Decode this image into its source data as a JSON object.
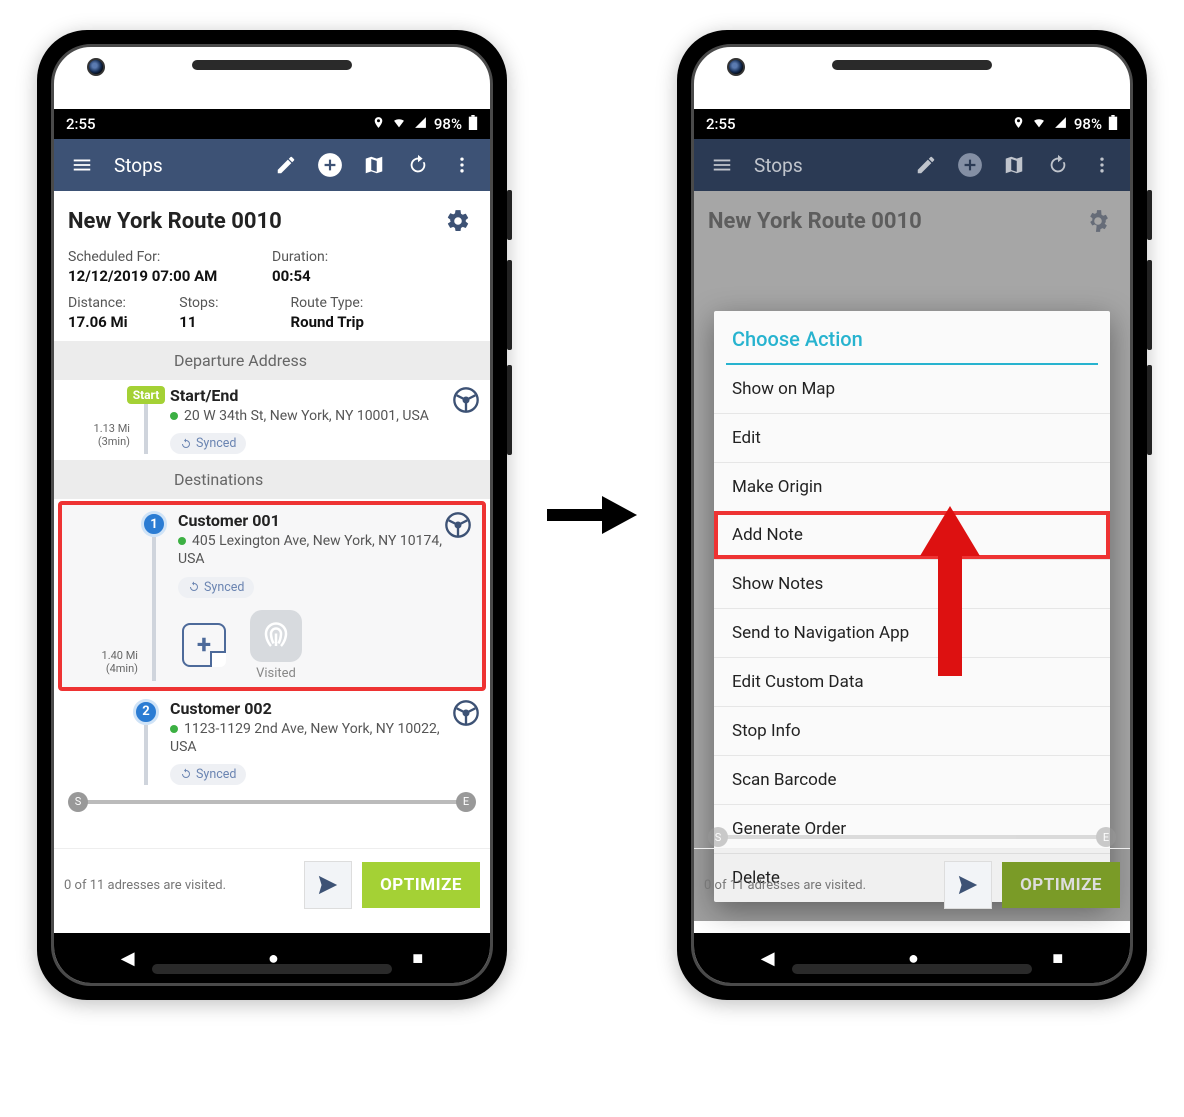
{
  "statusbar": {
    "time": "2:55",
    "battery": "98%"
  },
  "appbar": {
    "title": "Stops"
  },
  "route": {
    "name": "New York Route 0010",
    "scheduled_label": "Scheduled For:",
    "scheduled_value": "12/12/2019 07:00 AM",
    "duration_label": "Duration:",
    "duration_value": "00:54",
    "distance_label": "Distance:",
    "distance_value": "17.06 Mi",
    "stops_label": "Stops:",
    "stops_value": "11",
    "type_label": "Route Type:",
    "type_value": "Round Trip"
  },
  "sections": {
    "departure": "Departure Address",
    "destinations": "Destinations"
  },
  "start": {
    "badge": "Start",
    "title": "Start/End",
    "address": "20 W 34th St, New York, NY 10001, USA",
    "sync": "Synced",
    "dist": "1.13 Mi",
    "time": "(3min)"
  },
  "stops": [
    {
      "num": "1",
      "title": "Customer 001",
      "address": "405 Lexington Ave, New York, NY 10174, USA",
      "sync": "Synced",
      "dist": "1.40 Mi",
      "time": "(4min)",
      "visited_label": "Visited"
    },
    {
      "num": "2",
      "title": "Customer 002",
      "address": "1123-1129 2nd Ave, New York, NY 10022, USA",
      "sync": "Synced"
    }
  ],
  "slider": {
    "start": "S",
    "end": "E"
  },
  "footer": {
    "status": "0 of 11 adresses are visited.",
    "optimize": "OPTIMIZE"
  },
  "dialog": {
    "title": "Choose Action",
    "items": [
      "Show on Map",
      "Edit",
      "Make Origin",
      "Add Note",
      "Show Notes",
      "Send to Navigation App",
      "Edit Custom Data",
      "Stop Info",
      "Scan Barcode",
      "Generate Order",
      "Delete"
    ],
    "highlight_index": 3
  }
}
